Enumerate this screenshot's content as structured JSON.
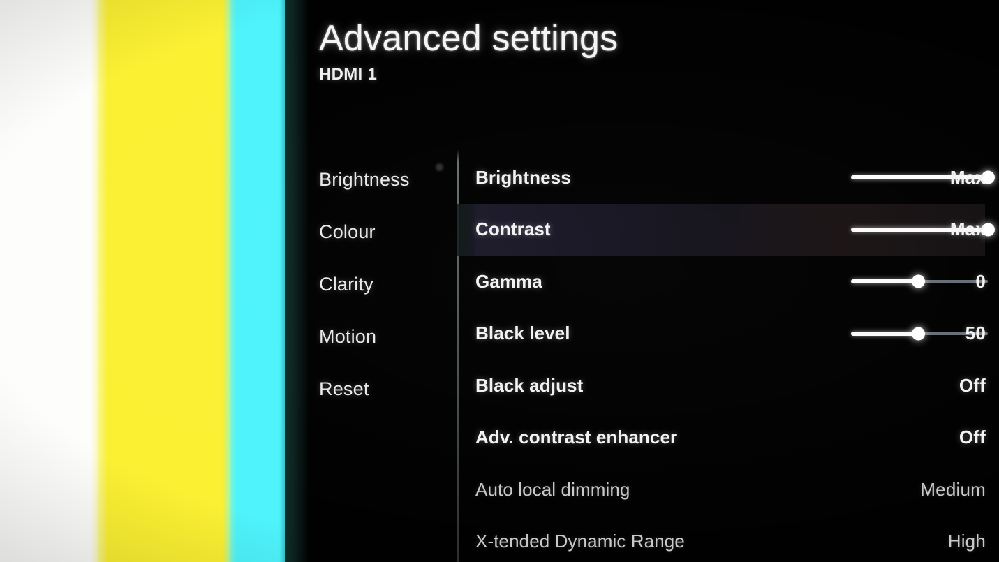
{
  "header": {
    "title": "Advanced settings",
    "subtitle": "HDMI 1"
  },
  "sidebar": {
    "items": [
      {
        "label": "Brightness"
      },
      {
        "label": "Colour"
      },
      {
        "label": "Clarity"
      },
      {
        "label": "Motion"
      },
      {
        "label": "Reset"
      }
    ]
  },
  "settings": {
    "rows": [
      {
        "label": "Brightness",
        "value": "Max",
        "slider": true,
        "percent": 100,
        "selected": false,
        "dim": false
      },
      {
        "label": "Contrast",
        "value": "Max",
        "slider": true,
        "percent": 100,
        "selected": true,
        "dim": false
      },
      {
        "label": "Gamma",
        "value": "0",
        "slider": true,
        "percent": 49,
        "selected": false,
        "dim": false
      },
      {
        "label": "Black level",
        "value": "50",
        "slider": true,
        "percent": 49,
        "selected": false,
        "dim": false
      },
      {
        "label": "Black adjust",
        "value": "Off",
        "slider": false,
        "percent": 0,
        "selected": false,
        "dim": false
      },
      {
        "label": "Adv. contrast enhancer",
        "value": "Off",
        "slider": false,
        "percent": 0,
        "selected": false,
        "dim": false
      },
      {
        "label": "Auto local dimming",
        "value": "Medium",
        "slider": false,
        "percent": 0,
        "selected": false,
        "dim": true
      },
      {
        "label": "X-tended Dynamic Range",
        "value": "High",
        "slider": false,
        "percent": 0,
        "selected": false,
        "dim": true
      }
    ]
  },
  "colorbars": {
    "bars": [
      {
        "name": "white",
        "color": "#fdfdfb"
      },
      {
        "name": "yellow",
        "color": "#fbf032"
      },
      {
        "name": "cyan",
        "color": "#4ef3fb"
      },
      {
        "name": "dark",
        "color": "#081a17"
      }
    ]
  }
}
